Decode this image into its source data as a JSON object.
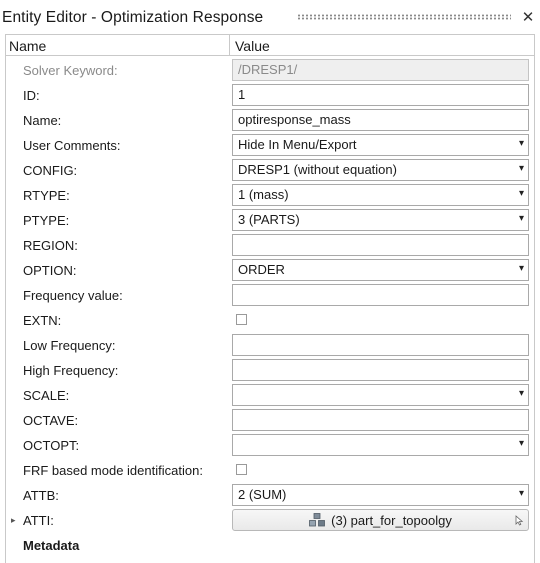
{
  "window": {
    "title": "Entity Editor - Optimization Response",
    "close_icon": "✕"
  },
  "table": {
    "header_name": "Name",
    "header_value": "Value"
  },
  "rows": {
    "solver_keyword": {
      "label": "Solver Keyword:",
      "value": "/DRESP1/"
    },
    "id": {
      "label": "ID:",
      "value": "1"
    },
    "name": {
      "label": "Name:",
      "value": "optiresponse_mass"
    },
    "user_comments": {
      "label": "User Comments:",
      "value": "Hide In Menu/Export"
    },
    "config": {
      "label": "CONFIG:",
      "value": "DRESP1 (without equation)"
    },
    "rtype": {
      "label": "RTYPE:",
      "value": "1 (mass)"
    },
    "ptype": {
      "label": "PTYPE:",
      "value": "3 (PARTS)"
    },
    "region": {
      "label": "REGION:",
      "value": ""
    },
    "option": {
      "label": "OPTION:",
      "value": "ORDER"
    },
    "frequency_value": {
      "label": "Frequency value:",
      "value": ""
    },
    "extn": {
      "label": "EXTN:",
      "checked": false
    },
    "low_frequency": {
      "label": "Low Frequency:",
      "value": ""
    },
    "high_frequency": {
      "label": "High Frequency:",
      "value": ""
    },
    "scale": {
      "label": "SCALE:",
      "value": ""
    },
    "octave": {
      "label": "OCTAVE:",
      "value": ""
    },
    "octopt": {
      "label": "OCTOPT:",
      "value": ""
    },
    "frf_mode_id": {
      "label": "FRF based mode identification:",
      "checked": false
    },
    "attb": {
      "label": "ATTB:",
      "value": "2 (SUM)"
    },
    "atti": {
      "label": "ATTI:",
      "value": "(3) part_for_topoolgy",
      "icon": "parts-icon",
      "expander": "▸"
    },
    "metadata": {
      "label": "Metadata"
    }
  },
  "icons": {
    "dropdown": "chevron-down-icon",
    "caret_glyph": "▾"
  },
  "colors": {
    "border": "#c9c9c9",
    "field_border": "#a9a9a9",
    "disabled_text": "#8a8a8a"
  }
}
